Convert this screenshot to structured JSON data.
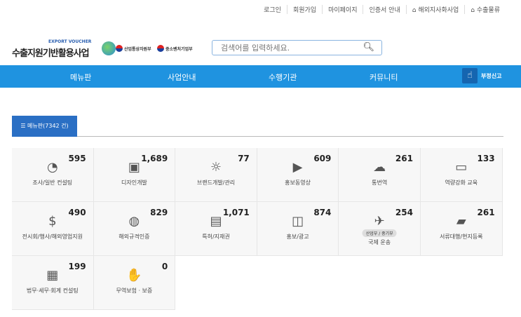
{
  "top_links": [
    {
      "label": "로그인"
    },
    {
      "label": "회원가입"
    },
    {
      "label": "마이페이지"
    },
    {
      "label": "인증서 안내"
    },
    {
      "label": "해외지사화사업",
      "icon": "home-icon"
    },
    {
      "label": "수출물류",
      "icon": "home-icon"
    }
  ],
  "logo": {
    "en": "EXPORT VOUCHER",
    "ko": "수출지원기반활용사업"
  },
  "ministries": [
    "산업통상자원부",
    "중소벤처기업부"
  ],
  "search": {
    "placeholder": "검색어를 입력하세요."
  },
  "nav": [
    "메뉴판",
    "사업안내",
    "수행기관",
    "커뮤니티"
  ],
  "report": "부정신고",
  "tab": "☰ 메뉴판(7342 건)",
  "cards": [
    {
      "label": "조사/일반 컨설팅",
      "count": "595",
      "icon": "◔"
    },
    {
      "label": "디자인개발",
      "count": "1,689",
      "icon": "▣"
    },
    {
      "label": "브랜드개발/관리",
      "count": "77",
      "icon": "☼"
    },
    {
      "label": "홍보동영상",
      "count": "609",
      "icon": "▶"
    },
    {
      "label": "통번역",
      "count": "261",
      "icon": "☁"
    },
    {
      "label": "역량강화 교육",
      "count": "133",
      "icon": "▭"
    },
    {
      "label": "전시회/행사/해외영업지원",
      "count": "490",
      "icon": "$"
    },
    {
      "label": "해외규격인증",
      "count": "829",
      "icon": "◍"
    },
    {
      "label": "특허/지재권",
      "count": "1,071",
      "icon": "▤"
    },
    {
      "label": "홍보/광고",
      "count": "874",
      "icon": "◫"
    },
    {
      "label": "국제 운송",
      "count": "254",
      "icon": "✈",
      "tag": "산업부 / 중기부"
    },
    {
      "label": "서류대행/현지등록",
      "count": "261",
      "icon": "▰"
    },
    {
      "label": "법무·세무·회계 컨설팅",
      "count": "199",
      "icon": "▦"
    },
    {
      "label": "무역보험 · 보증",
      "count": "0",
      "icon": "✋"
    }
  ]
}
